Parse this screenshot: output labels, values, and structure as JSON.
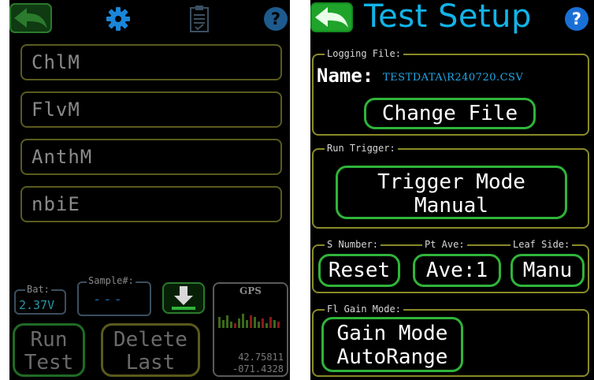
{
  "left": {
    "measurements": [
      "ChlM",
      "FlvM",
      "AnthM",
      "nbiE"
    ],
    "battery": {
      "label": "Bat:",
      "value": "2.37V"
    },
    "sample": {
      "label": "Sample#:",
      "value": "---"
    },
    "run_label": [
      "Run",
      "Test"
    ],
    "delete_label": [
      "Delete",
      "Last"
    ],
    "gps": {
      "label": "GPS",
      "lat": "42.75811",
      "lon": "-071.4328"
    },
    "icons": [
      "back-arrow-icon",
      "gear-icon",
      "clipboard-icon",
      "help-icon",
      "download-arrow-icon",
      "signal-bars-icon"
    ]
  },
  "right": {
    "title": "Test Setup",
    "logging": {
      "label": "Logging File:",
      "name_label": "Name:",
      "name_value": "TESTDATA\\R240720.CSV",
      "change_label": "Change File"
    },
    "run_trigger": {
      "label": "Run Trigger:",
      "button_lines": [
        "Trigger Mode",
        "Manual"
      ]
    },
    "s_number": {
      "label": "S Number:",
      "button": "Reset"
    },
    "pt_ave": {
      "label": "Pt Ave:",
      "button": "Ave:1"
    },
    "leaf_side": {
      "label": "Leaf Side:",
      "button": "Manu"
    },
    "gain": {
      "label": "Fl Gain Mode:",
      "button_lines": [
        "Gain Mode",
        "AutoRange"
      ]
    }
  },
  "colors": {
    "green_border": "#2fb43a",
    "olive_border": "#8a8a28",
    "title_blue": "#12b4e8",
    "help_blue": "#1a6fd6"
  }
}
